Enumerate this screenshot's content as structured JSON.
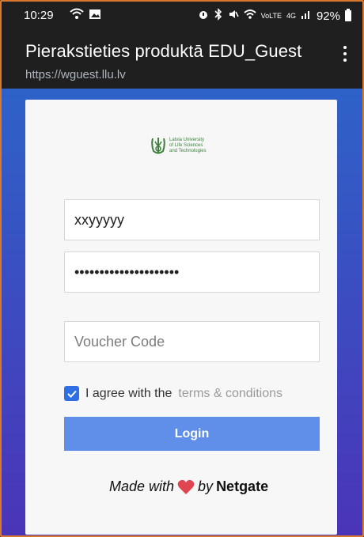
{
  "status": {
    "time": "10:29",
    "right_text": "92%",
    "icons": [
      "wifi-icon",
      "image-icon",
      "alarm-icon",
      "bluetooth-icon",
      "mute-icon",
      "wifi-icon",
      "volte-icon",
      "4g-icon",
      "signal-icon",
      "battery-icon"
    ],
    "volte_label": "VoLTE",
    "network_label": "4G"
  },
  "browser": {
    "title": "Pierakstieties produktā EDU_Guest",
    "url": "https://wguest.llu.lv",
    "menu_icon": "more-vert-icon"
  },
  "logo": {
    "line1": "Latvia University",
    "line2": "of Life Sciences",
    "line3": "and Technologies",
    "color": "#3d7f3b"
  },
  "form": {
    "username_value": "xxyyyyy",
    "password_value": "•••••••••••••••••••••",
    "voucher_placeholder": "Voucher Code",
    "agree_prefix": "I agree with the",
    "terms_link": "terms & conditions",
    "agree_checked": true,
    "login_label": "Login"
  },
  "footer": {
    "made_with": "Made with",
    "by": "by",
    "brand": "Netgate",
    "heart_color": "#e0464f"
  },
  "colors": {
    "accent": "#2f6fe3",
    "button": "#5f8fe8",
    "gradient_top": "#2e62c8",
    "gradient_bottom": "#4b34b8"
  }
}
